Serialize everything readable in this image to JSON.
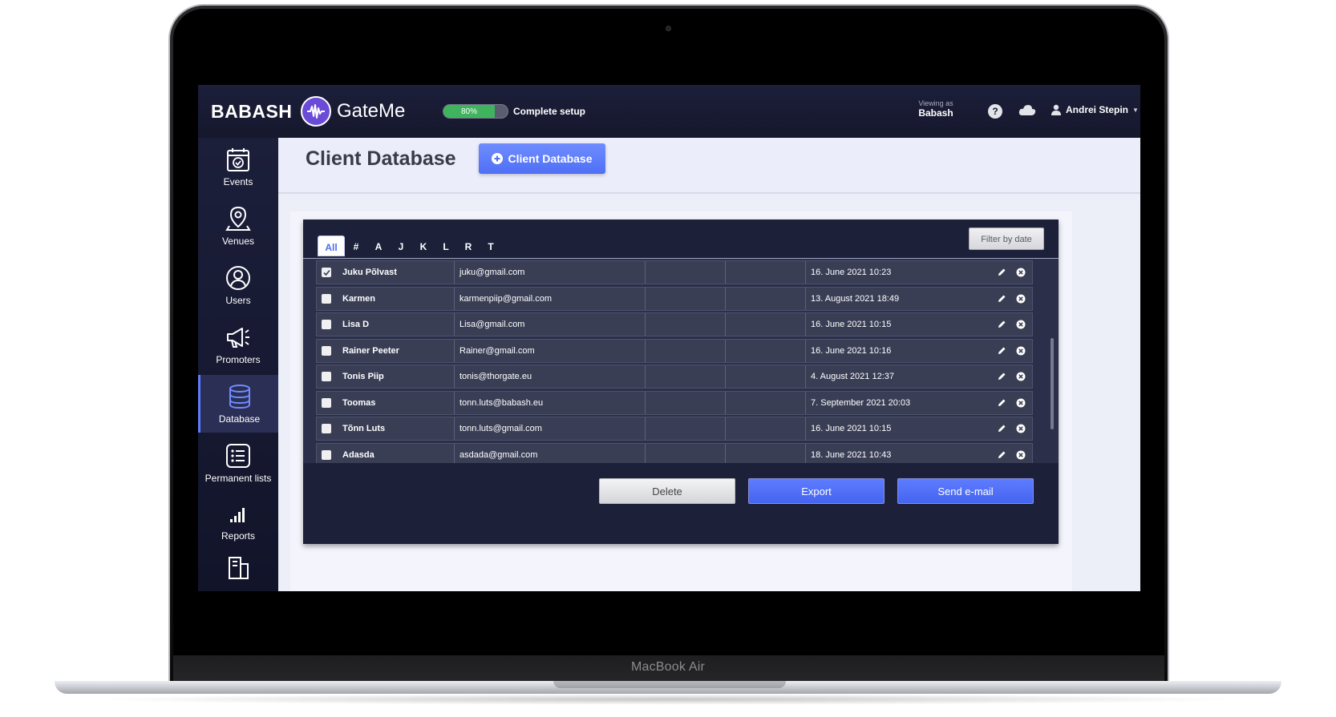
{
  "device": {
    "label": "MacBook Air"
  },
  "topbar": {
    "brand": "BABASH",
    "product": "GateMe",
    "setup_progress_percent": 80,
    "setup_progress_label": "80%",
    "setup_label": "Complete setup",
    "viewing_as_label": "Viewing as",
    "viewing_as_value": "Babash",
    "user_name": "Andrei Stepin",
    "icons": {
      "help": "help-icon",
      "cloud": "cloud-icon",
      "user": "user-icon",
      "caret": "caret-down-icon"
    }
  },
  "sidebar": {
    "items": [
      {
        "label": "Events",
        "icon": "calendar-icon",
        "active": false
      },
      {
        "label": "Venues",
        "icon": "location-pin-icon",
        "active": false
      },
      {
        "label": "Users",
        "icon": "user-circle-icon",
        "active": false
      },
      {
        "label": "Promoters",
        "icon": "megaphone-icon",
        "active": false
      },
      {
        "label": "Database",
        "icon": "database-icon",
        "active": true
      },
      {
        "label": "Permanent lists",
        "icon": "list-icon",
        "active": false
      },
      {
        "label": "Reports",
        "icon": "bar-chart-icon",
        "active": false
      }
    ]
  },
  "page": {
    "title": "Client Database",
    "add_button_label": "Client Database",
    "add_button_icon": "plus-circle-icon"
  },
  "filters": {
    "letters": [
      "All",
      "#",
      "A",
      "J",
      "K",
      "L",
      "R",
      "T"
    ],
    "active_letter": "All",
    "filter_by_date_label": "Filter by date"
  },
  "table": {
    "rows": [
      {
        "name": "Juku Põlvast",
        "email": "juku@gmail.com",
        "col3": "",
        "col4": "",
        "date": "16. June 2021 10:23",
        "checked": true
      },
      {
        "name": "Karmen",
        "email": "karmenpiip@gmail.com",
        "col3": "",
        "col4": "",
        "date": "13. August 2021 18:49",
        "checked": false
      },
      {
        "name": "Lisa D",
        "email": "Lisa@gmail.com",
        "col3": "",
        "col4": "",
        "date": "16. June 2021 10:15",
        "checked": false
      },
      {
        "name": "Rainer Peeter",
        "email": "Rainer@gmail.com",
        "col3": "",
        "col4": "",
        "date": "16. June 2021 10:16",
        "checked": false
      },
      {
        "name": "Tonis Piip",
        "email": "tonis@thorgate.eu",
        "col3": "",
        "col4": "",
        "date": "4. August 2021 12:37",
        "checked": false
      },
      {
        "name": "Toomas",
        "email": "tonn.luts@babash.eu",
        "col3": "",
        "col4": "",
        "date": "7. September 2021 20:03",
        "checked": false
      },
      {
        "name": "Tõnn Luts",
        "email": "tonn.luts@gmail.com",
        "col3": "",
        "col4": "",
        "date": "16. June 2021 10:15",
        "checked": false
      },
      {
        "name": "Adasda",
        "email": "asdada@gmail.com",
        "col3": "",
        "col4": "",
        "date": "18. June 2021 10:43",
        "checked": false
      }
    ],
    "row_icons": {
      "edit": "pencil-icon",
      "delete": "close-circle-icon"
    }
  },
  "actions": {
    "delete_label": "Delete",
    "export_label": "Export",
    "send_label": "Send e-mail"
  },
  "colors": {
    "accent": "#5d7cff",
    "navy": "#1c1f3a",
    "progress": "#3fb35d"
  }
}
